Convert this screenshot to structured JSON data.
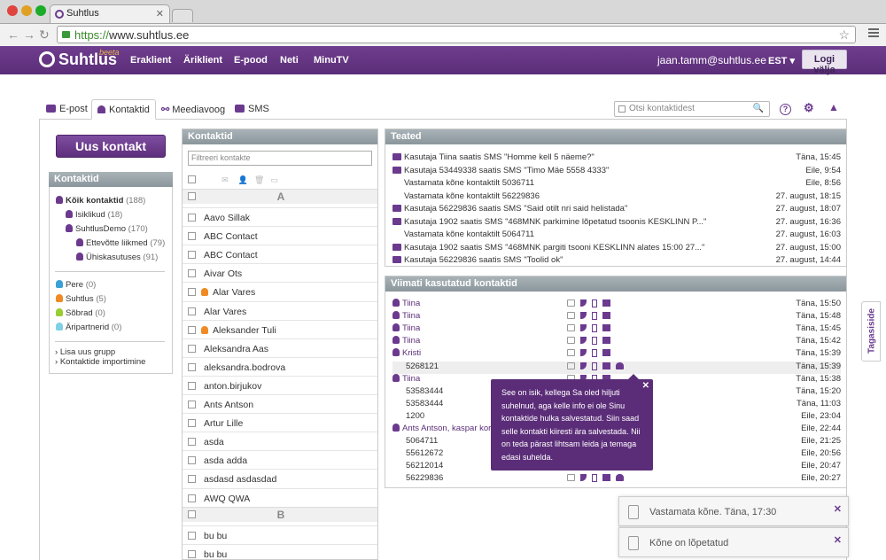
{
  "browser": {
    "tab_title": "Suhtlus",
    "url_scheme": "https://",
    "url_rest": "www.suhtlus.ee"
  },
  "nav": {
    "logo": "Suhtlus",
    "beta": "beeta",
    "links": [
      "Eraklient",
      "Äriklient",
      "E-pood",
      "Neti",
      "MinuTV"
    ],
    "user_email": "jaan.tamm@suhtlus.ee",
    "language": "EST",
    "logout": "Logi välja"
  },
  "tabs": [
    "E-post",
    "Kontaktid",
    "Meediavoog",
    "SMS"
  ],
  "search": {
    "placeholder": "Otsi kontaktidest"
  },
  "sidebar": {
    "new_contact": "Uus kontakt",
    "header": "Kontaktid",
    "groups": [
      {
        "label": "Kõik kontaktid",
        "count": "(188)"
      },
      {
        "label": "Isiklikud",
        "count": "(18)"
      },
      {
        "label": "SuhtlusDemo",
        "count": "(170)"
      },
      {
        "label": "Ettevõtte liikmed",
        "count": "(79)"
      },
      {
        "label": "Ühiskasutuses",
        "count": "(91)"
      }
    ],
    "tags": [
      {
        "label": "Pere",
        "count": "(0)",
        "color": "#3aa0d8"
      },
      {
        "label": "Suhtlus",
        "count": "(5)",
        "color": "#f08a24"
      },
      {
        "label": "Sõbrad",
        "count": "(0)",
        "color": "#9acd32"
      },
      {
        "label": "Äripartnerid",
        "count": "(0)",
        "color": "#7fd0e6"
      }
    ],
    "links": [
      "Lisa uus grupp",
      "Kontaktide importimine"
    ]
  },
  "contacts": {
    "header": "Kontaktid",
    "filter_placeholder": "Filtreeri kontakte",
    "letters": [
      "A",
      "B"
    ],
    "rows_a": [
      "Aavo Sillak",
      "ABC Contact",
      "ABC Contact",
      "Aivar Ots",
      "Alar Vares",
      "Alar Vares",
      "Aleksander Tuli",
      "Aleksandra Aas",
      "aleksandra.bodrova",
      "anton.birjukov",
      "Ants Antson",
      "Artur Lille",
      "asda",
      "asda adda",
      "asdasd asdasdad",
      "AWQ QWA"
    ],
    "rows_b": [
      "bu bu",
      "bu bu"
    ]
  },
  "feed": {
    "header": "Teated",
    "rows": [
      {
        "text": "Kasutaja Tiina saatis SMS \"Homme kell 5 näeme?\"",
        "time": "Täna, 15:45",
        "sms": true
      },
      {
        "text": "Kasutaja 53449338 saatis SMS \"Timo Mäe 5558 4333\"",
        "time": "Eile, 9:54",
        "sms": true
      },
      {
        "text": "Vastamata kõne kontaktilt 5036711",
        "time": "Eile, 8:56",
        "sms": false
      },
      {
        "text": "Vastamata kõne kontaktilt 56229836",
        "time": "27. august, 18:15",
        "sms": false
      },
      {
        "text": "Kasutaja 56229836 saatis SMS \"Said otilt nri said helistada\"",
        "time": "27. august, 18:07",
        "sms": true
      },
      {
        "text": "Kasutaja 1902 saatis SMS \"468MNK parkimine lõpetatud tsoonis KESKLINN P...\"",
        "time": "27. august, 16:36",
        "sms": true
      },
      {
        "text": "Vastamata kõne kontaktilt 5064711",
        "time": "27. august, 16:03",
        "sms": false
      },
      {
        "text": "Kasutaja 1902 saatis SMS \"468MNK pargiti tsooni KESKLINN alates 15:00 27...\"",
        "time": "27. august, 15:00",
        "sms": true
      },
      {
        "text": "Kasutaja 56229836 saatis SMS \"Toolid ok\"",
        "time": "27. august, 14:44",
        "sms": true
      }
    ]
  },
  "recent": {
    "header": "Viimati kasutatud kontaktid",
    "rows": [
      {
        "name": "Tiina",
        "time": "Täna, 15:50",
        "person": true
      },
      {
        "name": "Tiina",
        "time": "Täna, 15:48",
        "person": true
      },
      {
        "name": "Tiina",
        "time": "Täna, 15:45",
        "person": true
      },
      {
        "name": "Tiina",
        "time": "Täna, 15:42",
        "person": true
      },
      {
        "name": "Kristi",
        "time": "Täna, 15:39",
        "person": true
      },
      {
        "name": "5268121",
        "time": "Täna, 15:39",
        "person": false
      },
      {
        "name": "Tiina",
        "time": "Täna, 15:38",
        "person": true
      },
      {
        "name": "53583444",
        "time": "Täna, 15:20",
        "person": false
      },
      {
        "name": "53583444",
        "time": "Täna, 11:03",
        "person": false
      },
      {
        "name": "1200",
        "time": "Eile, 23:04",
        "person": false
      },
      {
        "name": "Ants Antson, kaspar korju",
        "time": "Eile, 22:44",
        "person": true
      },
      {
        "name": "5064711",
        "time": "Eile, 21:25",
        "person": false
      },
      {
        "name": "55612672",
        "time": "Eile, 20:56",
        "person": false
      },
      {
        "name": "56212014",
        "time": "Eile, 20:47",
        "person": false
      },
      {
        "name": "56229836",
        "time": "Eile, 20:27",
        "person": false
      }
    ]
  },
  "tooltip": {
    "text": "See on isik, kellega Sa oled hiljuti suhelnud, aga kelle info ei ole Sinu kontaktide hulka salvestatud. Siin saad selle kontakti kiiresti ära salvestada. Nii on teda pärast lihtsam leida ja temaga edasi suhelda."
  },
  "feedback": "Tagasiside",
  "notifications": [
    "Vastamata kõne. Täna, 17:30",
    "Kõne on lõpetatud"
  ],
  "colors": {
    "brand": "#6b3a8f",
    "nav": "#5b2d78"
  }
}
